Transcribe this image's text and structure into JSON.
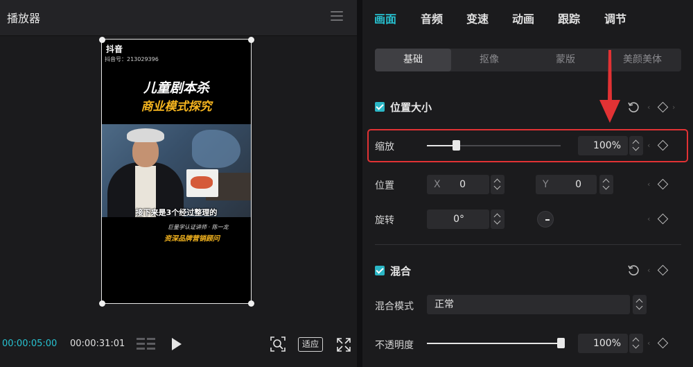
{
  "player": {
    "title": "播放器",
    "time_current": "00:00:05:00",
    "time_total": "00:00:31:01",
    "fit_label": "适应",
    "video": {
      "logo": "抖音",
      "account_id": "抖音号：213029396",
      "title_line1": "儿童剧本杀",
      "title_line2": "商业模式探究",
      "subtitle": "接下来是3个经过整理的",
      "caption_line1": "巨量学认证讲师 · 陈一龙",
      "caption_line2": "资深品牌营销顾问"
    }
  },
  "props": {
    "tabs": [
      {
        "label": "画面",
        "active": true
      },
      {
        "label": "音频"
      },
      {
        "label": "变速"
      },
      {
        "label": "动画"
      },
      {
        "label": "跟踪"
      },
      {
        "label": "调节"
      }
    ],
    "subtabs": [
      {
        "label": "基础",
        "active": true
      },
      {
        "label": "抠像"
      },
      {
        "label": "蒙版"
      },
      {
        "label": "美颜美体"
      }
    ],
    "position_size": {
      "title": "位置大小",
      "checked": true,
      "scale_label": "缩放",
      "scale_value": "100%",
      "scale_fraction": 0.22,
      "position_label": "位置",
      "x_prefix": "X",
      "x_value": "0",
      "y_prefix": "Y",
      "y_value": "0",
      "rotation_label": "旋转",
      "rotation_value": "0°"
    },
    "blend": {
      "title": "混合",
      "checked": true,
      "mode_label": "混合模式",
      "mode_value": "正常",
      "opacity_label": "不透明度",
      "opacity_value": "100%",
      "opacity_fraction": 1.0
    }
  },
  "colors": {
    "accent": "#27c2d1",
    "highlight": "#e23234",
    "background": "#1b1b1d"
  }
}
